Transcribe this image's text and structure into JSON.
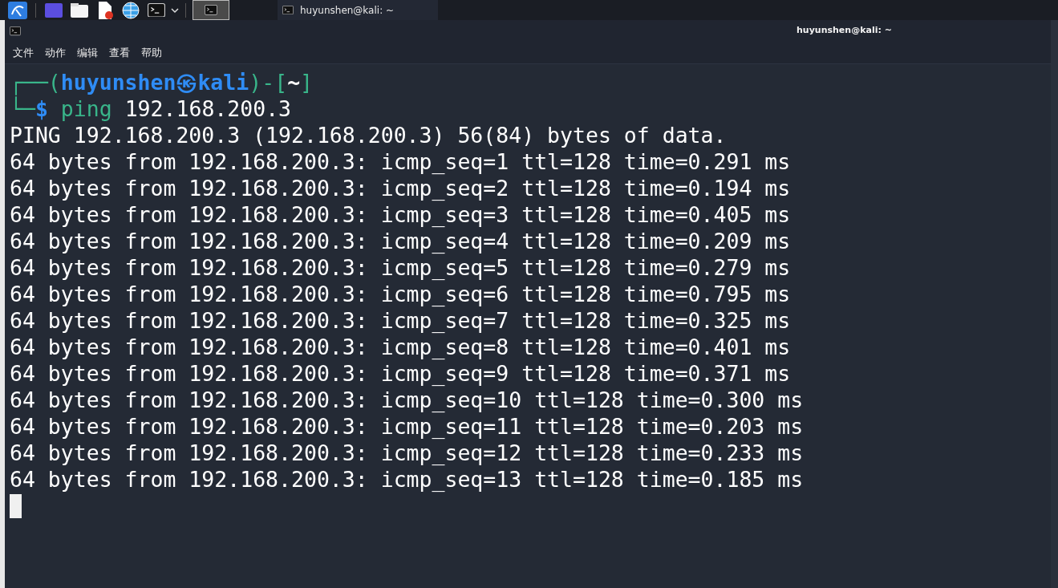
{
  "taskbar": {
    "tasks": [
      {
        "title": "huyunshen@kali: ~",
        "selected": false
      }
    ]
  },
  "window": {
    "title": "huyunshen@kali: ~"
  },
  "menu": [
    "文件",
    "动作",
    "编辑",
    "查看",
    "帮助"
  ],
  "terminal": {
    "prompt": {
      "open": "┌──(",
      "user": "huyunshen㉿kali",
      "mid": ")-[",
      "dir": "~",
      "close": "]",
      "corner": "└─",
      "symbol": "$",
      "command": "ping",
      "args": "192.168.200.3"
    },
    "output": [
      "PING 192.168.200.3 (192.168.200.3) 56(84) bytes of data.",
      "64 bytes from 192.168.200.3: icmp_seq=1 ttl=128 time=0.291 ms",
      "64 bytes from 192.168.200.3: icmp_seq=2 ttl=128 time=0.194 ms",
      "64 bytes from 192.168.200.3: icmp_seq=3 ttl=128 time=0.405 ms",
      "64 bytes from 192.168.200.3: icmp_seq=4 ttl=128 time=0.209 ms",
      "64 bytes from 192.168.200.3: icmp_seq=5 ttl=128 time=0.279 ms",
      "64 bytes from 192.168.200.3: icmp_seq=6 ttl=128 time=0.795 ms",
      "64 bytes from 192.168.200.3: icmp_seq=7 ttl=128 time=0.325 ms",
      "64 bytes from 192.168.200.3: icmp_seq=8 ttl=128 time=0.401 ms",
      "64 bytes from 192.168.200.3: icmp_seq=9 ttl=128 time=0.371 ms",
      "64 bytes from 192.168.200.3: icmp_seq=10 ttl=128 time=0.300 ms",
      "64 bytes from 192.168.200.3: icmp_seq=11 ttl=128 time=0.203 ms",
      "64 bytes from 192.168.200.3: icmp_seq=12 ttl=128 time=0.233 ms",
      "64 bytes from 192.168.200.3: icmp_seq=13 ttl=128 time=0.185 ms"
    ]
  }
}
